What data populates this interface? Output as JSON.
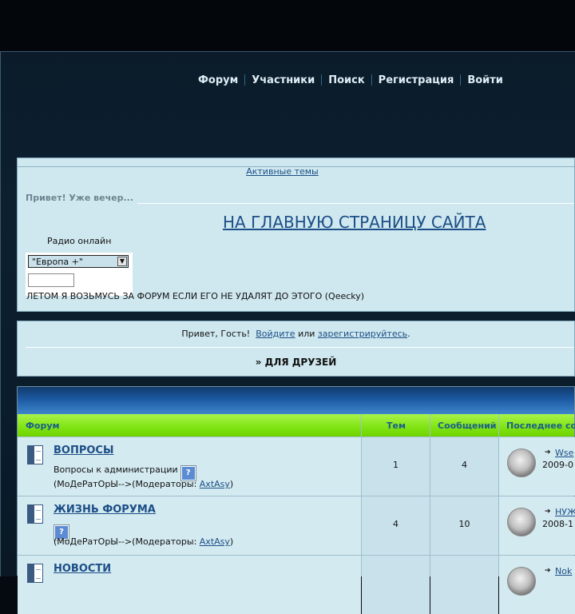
{
  "nav": {
    "items": [
      "Форум",
      "Участники",
      "Поиск",
      "Регистрация",
      "Войти"
    ]
  },
  "announce": {
    "active_topics": "Активные темы",
    "greeting_evening": "Привет! Уже вечер...",
    "main_site_link": "НА ГЛАВНУЮ СТРАНИЦУ САЙТА",
    "radio_label": "Радио онлайн",
    "radio_selected": "\"Европа +\"",
    "radio_input_value": "",
    "summer_note": "ЛЕТОМ Я ВОЗЬМУСЬ ЗА ФОРУМ ЕСЛИ ЕГО НЕ УДАЛЯТ ДО ЭТОГО (Qeecky)"
  },
  "guest": {
    "hello": "Привет, Гость!",
    "login_link": "Войдите",
    "or": "или",
    "register_link": "зарегистрируйтесь",
    "dot": ".",
    "category": "» ДЛЯ ДРУЗЕЙ"
  },
  "table": {
    "headers": {
      "forum": "Форум",
      "topics": "Тем",
      "posts": "Сообщений",
      "last_post": "Последнее сооб"
    },
    "rows": [
      {
        "title": "ВОПРОСЫ",
        "description": "Вопросы к администрации",
        "mods_prefix": "(МоДеРатОрЫ-->(Модераторы: ",
        "mod_name": "AxtAsy",
        "mods_suffix": ")",
        "topics": "1",
        "posts": "4",
        "last_link": "Wse",
        "last_date": "2009-0"
      },
      {
        "title": "ЖИЗНЬ ФОРУМА",
        "description": "",
        "mods_prefix": "(МоДеРатОрЫ-->(Модераторы: ",
        "mod_name": "AxtAsy",
        "mods_suffix": ")",
        "topics": "4",
        "posts": "10",
        "last_link": "НУЖ",
        "last_date": "2008-1"
      },
      {
        "title": "НОВОСТИ",
        "last_link": "Nok"
      }
    ]
  },
  "icons": {
    "forum_icon": "forum-folder-icon",
    "question_icon": "question-mark-icon",
    "arrow_icon": "arrow-right-icon",
    "select_arrow": "chevron-down-icon"
  },
  "colors": {
    "link": "#1c4e87",
    "panel_bg": "#cfe8ef",
    "header_green": "#82e515",
    "header_blue": "#1b5aa2"
  }
}
